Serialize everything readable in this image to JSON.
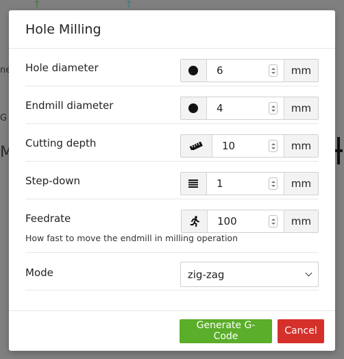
{
  "dialog": {
    "title": "Hole Milling"
  },
  "fields": [
    {
      "label": "Hole diameter",
      "icon": "circle-icon",
      "value": "6",
      "unit": "mm"
    },
    {
      "label": "Endmill diameter",
      "icon": "circle-icon",
      "value": "4",
      "unit": "mm"
    },
    {
      "label": "Cutting depth",
      "icon": "ruler-icon",
      "value": "10",
      "unit": "mm"
    },
    {
      "label": "Step-down",
      "icon": "layers-icon",
      "value": "1",
      "unit": "mm"
    },
    {
      "label": "Feedrate",
      "icon": "running-person-icon",
      "value": "100",
      "unit": "mm",
      "help": "How fast to move the endmill in milling operation"
    }
  ],
  "mode": {
    "label": "Mode",
    "selected": "zig-zag"
  },
  "footer": {
    "generate_label": "Generate G-Code",
    "cancel_label": "Cancel"
  },
  "colors": {
    "primary": "#5aae2a",
    "danger": "#d6302b",
    "overlay": "#808080"
  }
}
